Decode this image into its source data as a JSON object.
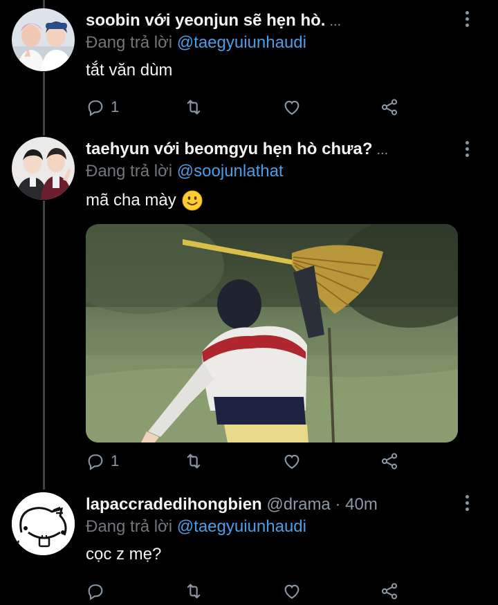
{
  "tweets": [
    {
      "display_name": "soobin với yeonjun sẽ hẹn hò.",
      "truncated": "...",
      "reply_prefix": "Đang trả lời",
      "reply_mention": "@taegyuiunhaudi",
      "text": "tắt văn dùm",
      "reply_count": "1"
    },
    {
      "display_name": "taehyun với beomgyu hẹn hò chưa?",
      "truncated": "...",
      "reply_prefix": "Đang trả lời",
      "reply_mention": "@soojunlathat",
      "text": "mã cha mày",
      "reply_count": "1"
    },
    {
      "display_name": "lapaccradedihongbien",
      "handle": "@drama",
      "separator": "·",
      "time": "40m",
      "reply_prefix": "Đang trả lời",
      "reply_mention": "@taegyuiunhaudi",
      "text": "cọc z mẹ?",
      "reply_count": ""
    }
  ],
  "icons": {
    "reply": "reply-icon",
    "retweet": "retweet-icon",
    "like": "heart-icon",
    "share": "share-icon",
    "more": "more-vertical-icon"
  },
  "colors": {
    "background": "#000000",
    "link": "#4a9ee8",
    "muted": "#8b98a5"
  }
}
